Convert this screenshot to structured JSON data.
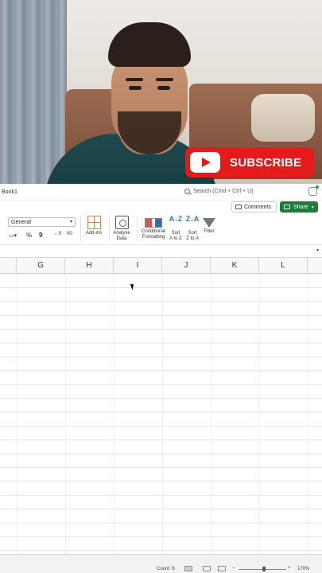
{
  "overlay": {
    "subscribe_label": "SUBSCRIBE",
    "brand_color": "#e41b1b"
  },
  "titlebar": {
    "title": "Book1",
    "search_placeholder": "Search (Cmd + Ctrl + U)"
  },
  "ribbon": {
    "comments_label": "Comments",
    "share_label": "Share",
    "share_color": "#1e7d3a",
    "number_format": "General",
    "percent_symbol": "%",
    "comma_symbol": "9",
    "addins_label": "Add-ins",
    "analyse_label_line1": "Analyse",
    "analyse_label_line2": "Data",
    "cf_label_line1": "Conditional",
    "cf_label_line2": "Formatting",
    "sort_az_line1": "Sort",
    "sort_az_line2": "A to Z",
    "sort_za_line1": "Sort",
    "sort_za_line2": "Z to A",
    "filter_label": "Filter",
    "sort_az_icon_text": "A↓Z",
    "sort_za_icon_text": "Z↓A"
  },
  "grid": {
    "columns": [
      "G",
      "H",
      "I",
      "J",
      "K",
      "L"
    ]
  },
  "status": {
    "count": "Count: 6",
    "zoom": "170%",
    "zoom_minus": "−",
    "zoom_plus": "+"
  }
}
